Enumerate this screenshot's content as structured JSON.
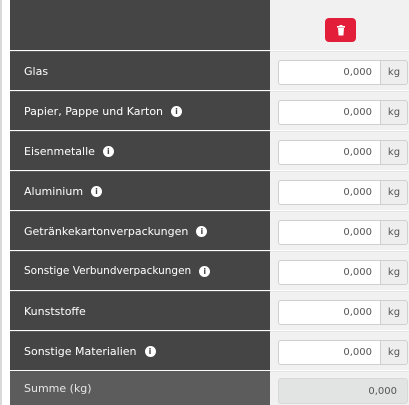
{
  "header": {
    "delete_icon": "trash-icon",
    "accent_color": "#e31e3b"
  },
  "rows": [
    {
      "label": "Glas",
      "value": "0,000",
      "unit": "kg",
      "info": false
    },
    {
      "label": "Papier, Pappe und Karton",
      "value": "0,000",
      "unit": "kg",
      "info": true
    },
    {
      "label": "Eisenmetalle",
      "value": "0,000",
      "unit": "kg",
      "info": true
    },
    {
      "label": "Aluminium",
      "value": "0,000",
      "unit": "kg",
      "info": true
    },
    {
      "label": "Getränkekartonverpackungen",
      "value": "0,000",
      "unit": "kg",
      "info": true
    },
    {
      "label": "Sonstige Verbundverpackungen",
      "value": "0,000",
      "unit": "kg",
      "info": true
    },
    {
      "label": "Kunststoffe",
      "value": "0,000",
      "unit": "kg",
      "info": false
    },
    {
      "label": "Sonstige Materialien",
      "value": "0,000",
      "unit": "kg",
      "info": true
    }
  ],
  "sum": {
    "label": "Summe (kg)",
    "value": "0,000"
  },
  "info_icon_glyph": "i"
}
